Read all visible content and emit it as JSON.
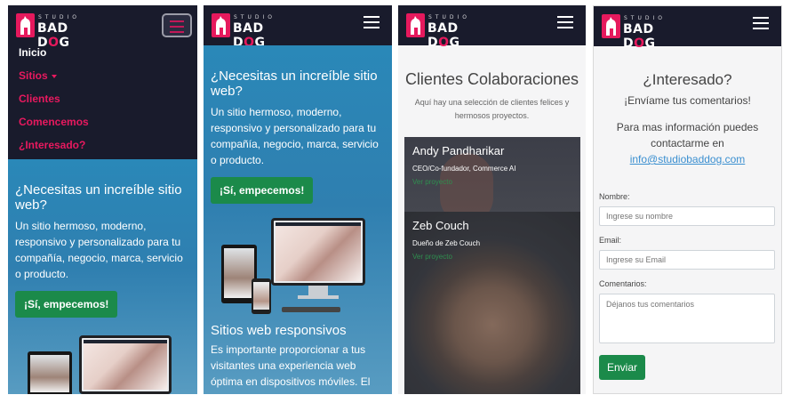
{
  "brand": {
    "studio": "STUDIO",
    "name_a": "BAD D",
    "name_o": "O",
    "name_b": "G"
  },
  "nav": {
    "items": [
      {
        "label": "Inicio"
      },
      {
        "label": "Sitios"
      },
      {
        "label": "Clientes"
      },
      {
        "label": "Comencemos"
      },
      {
        "label": "¿Interesado?"
      }
    ]
  },
  "hero": {
    "title": "¿Necesitas un increíble sitio web?",
    "text": "Un sitio hermoso, moderno, responsivo y personalizado para tu compañía, negocio, marca, servicio o producto.",
    "cta": "¡Sí, empecemos!"
  },
  "responsive": {
    "title": "Sitios web responsivos",
    "text": "Es importante proporcionar a tus visitantes una experiencia web óptima en dispositivos móviles. El"
  },
  "clients": {
    "title": "Clientes Colaboraciones",
    "subtitle": "Aquí hay una selección de clientes felices y hermosos proyectos.",
    "cards": [
      {
        "name": "Andy Pandharikar",
        "role": "CEO/Co-fundador, Commerce AI",
        "link": "Ver proyecto"
      },
      {
        "name": "Zeb Couch",
        "role": "Dueño de Zeb Couch",
        "link": "Ver proyecto"
      }
    ]
  },
  "contact": {
    "title": "¿Interesado?",
    "subtitle": "¡Envíame tus comentarios!",
    "info": "Para mas información puedes contactarme en",
    "email": "info@studiobaddog.com",
    "name_label": "Nombre:",
    "name_placeholder": "Ingrese su nombre",
    "email_label": "Email:",
    "email_placeholder": "Ingrese su Email",
    "comments_label": "Comentarios:",
    "comments_placeholder": "Déjanos tus comentarios",
    "submit": "Enviar"
  },
  "colors": {
    "accent": "#e8195f",
    "navbar": "#191b2c",
    "green": "#1b8a4a",
    "hero": "#2f7fb0"
  }
}
